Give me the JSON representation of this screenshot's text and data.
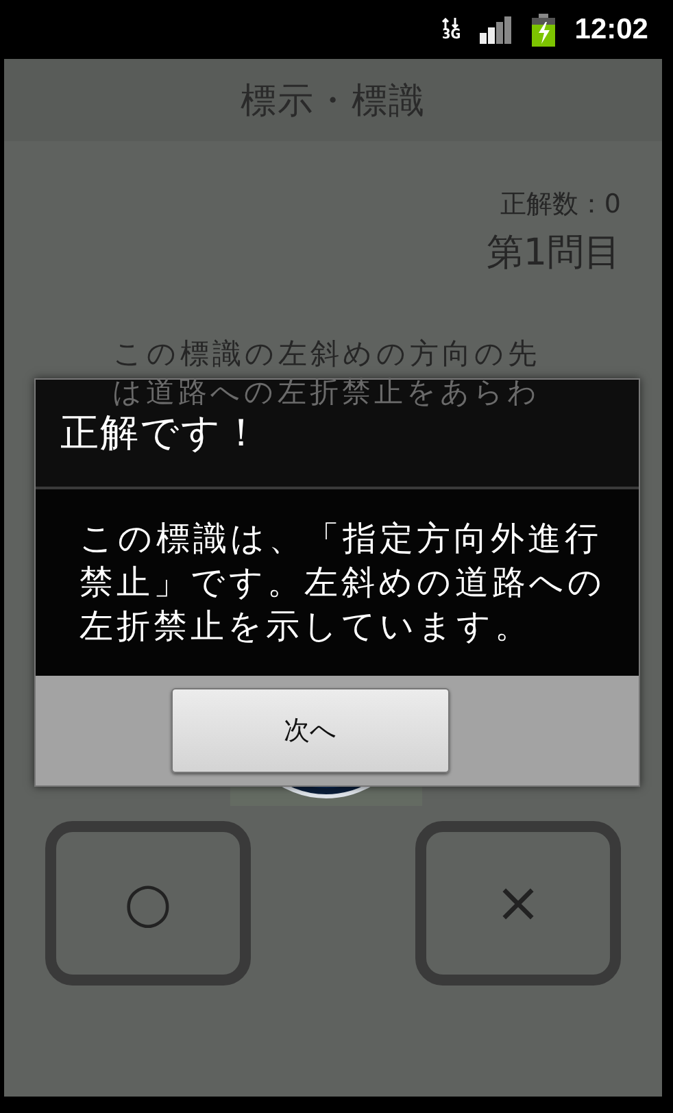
{
  "status_bar": {
    "network": "3G",
    "time": "12:02"
  },
  "title": "標示・標識",
  "score": "正解数：0",
  "question_number": "第1問目",
  "question_lines": [
    "この標識の左斜めの方向の先",
    "は道路への左折禁止をあらわ"
  ],
  "answer_buttons": [
    {
      "label": "○"
    },
    {
      "label": "×"
    }
  ],
  "dialog": {
    "title": "正解です！",
    "message_lines": [
      "この標識は、「指定方向外進行",
      "禁止」です。左斜めの道路への",
      "左折禁止を示しています。"
    ],
    "button": "次へ"
  }
}
